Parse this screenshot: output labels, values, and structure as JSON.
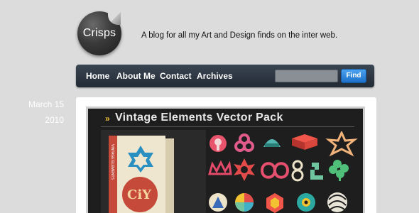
{
  "header": {
    "logo_text": "Crisps",
    "tagline": "A blog for all my Art and Design finds on the inter web."
  },
  "nav": {
    "items": [
      {
        "label": "Home"
      },
      {
        "label": "About Me"
      },
      {
        "label": "Contact"
      },
      {
        "label": "Archives"
      }
    ],
    "search": {
      "value": "",
      "placeholder": ""
    },
    "find_label": "Find"
  },
  "post": {
    "date_month": "March 15",
    "date_year": "2010",
    "image_title": "Vintage Elements Vector Pack",
    "image_arrows": "»",
    "book_spine": "VINTAGE ELEMENTS",
    "book_cover_text": "CiY"
  },
  "colors": {
    "background": "#dcdcdc",
    "nav_bar": "#2c3540",
    "find_button": "#2f86dc",
    "accent_red": "#c64a3a",
    "title_arrow": "#f2c230"
  }
}
